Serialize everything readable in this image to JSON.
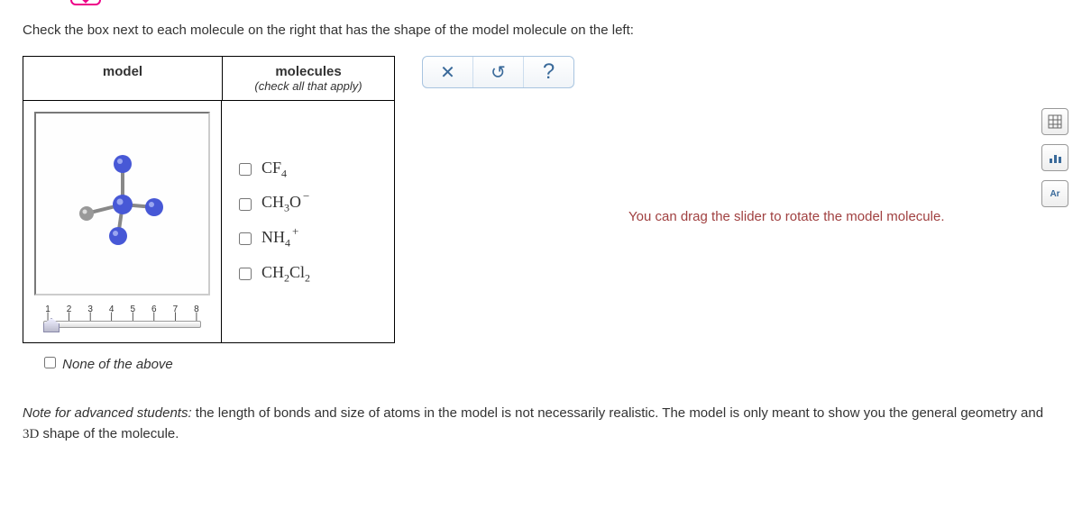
{
  "instruction": "Check the box next to each molecule on the right that has the shape of the model molecule on the left:",
  "headers": {
    "model": "model",
    "molecules": "molecules",
    "molecules_sub": "(check all that apply)"
  },
  "options": [
    {
      "base": "CF",
      "sub": "4",
      "sup": ""
    },
    {
      "base": "CH",
      "sub": "3",
      "tail": "O",
      "sup": "−"
    },
    {
      "base": "NH",
      "sub": "4",
      "sup": "+"
    },
    {
      "base": "CH",
      "sub": "2",
      "tail": "Cl",
      "sub2": "2",
      "sup": ""
    }
  ],
  "none_label": "None of the above",
  "slider_ticks": [
    "1",
    "2",
    "3",
    "4",
    "5",
    "6",
    "7",
    "8"
  ],
  "hint": "You can drag the slider to rotate the model molecule.",
  "note_prefix": "Note for advanced students:",
  "note_body": " the length of bonds and size of atoms in the model is not necessarily realistic. The model is only meant to show you the general geometry and ",
  "note_3d": "3D",
  "note_tail": " shape of the molecule.",
  "controls": {
    "close": "✕",
    "undo": "↺",
    "help": "?"
  },
  "side": {
    "grid": "⊞",
    "bars": "₀₀₀",
    "ar": "Ar"
  }
}
